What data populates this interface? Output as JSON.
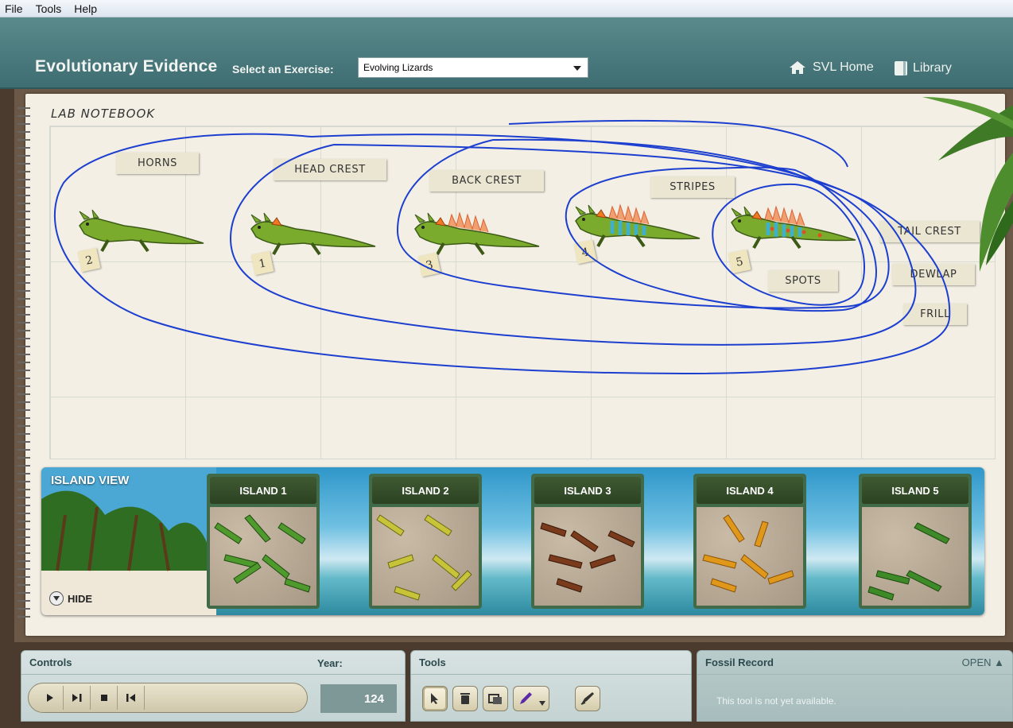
{
  "menu": [
    "File",
    "Tools",
    "Help"
  ],
  "header": {
    "title": "Evolutionary Evidence",
    "select_label": "Select an Exercise:",
    "exercise_value": "Evolving Lizards",
    "home_label": "SVL Home",
    "library_label": "Library"
  },
  "notebook": {
    "label": "LAB NOTEBOOK",
    "trait_tags": [
      "HORNS",
      "HEAD CREST",
      "BACK CREST",
      "STRIPES",
      "TAIL CREST",
      "DEWLAP",
      "SPOTS",
      "FRILL"
    ],
    "lizards": [
      {
        "number": "2",
        "traits": [
          "horns"
        ]
      },
      {
        "number": "1",
        "traits": [
          "horns",
          "head crest"
        ]
      },
      {
        "number": "3",
        "traits": [
          "horns",
          "head crest",
          "back crest"
        ]
      },
      {
        "number": "4",
        "traits": [
          "horns",
          "head crest",
          "back crest",
          "stripes"
        ]
      },
      {
        "number": "5",
        "traits": [
          "horns",
          "head crest",
          "back crest",
          "stripes",
          "spots"
        ]
      }
    ]
  },
  "island_view": {
    "label": "ISLAND VIEW",
    "hide_label": "HIDE",
    "islands": [
      {
        "name": "ISLAND 1",
        "lizard_color": "#4f9a2c"
      },
      {
        "name": "ISLAND 2",
        "lizard_color": "#c8c43a"
      },
      {
        "name": "ISLAND 3",
        "lizard_color": "#7a3a1c"
      },
      {
        "name": "ISLAND 4",
        "lizard_color": "#e0981a"
      },
      {
        "name": "ISLAND 5",
        "lizard_color": "#3f8a28"
      }
    ]
  },
  "controls": {
    "title": "Controls",
    "year_label": "Year:",
    "year_value": "124",
    "buttons": [
      "play-icon",
      "step-icon",
      "stop-icon",
      "rewind-icon"
    ]
  },
  "tools": {
    "title": "Tools",
    "items": [
      "pointer-icon",
      "trash-icon",
      "screenshot-icon",
      "pen-icon",
      "eraser-icon"
    ]
  },
  "fossil_record": {
    "title": "Fossil Record",
    "open_label": "OPEN ▲",
    "note": "This tool is not yet available."
  },
  "colors": {
    "header": "#4a7a7e",
    "scribble": "#1d3fd0",
    "notebook": "#f3efe4"
  }
}
